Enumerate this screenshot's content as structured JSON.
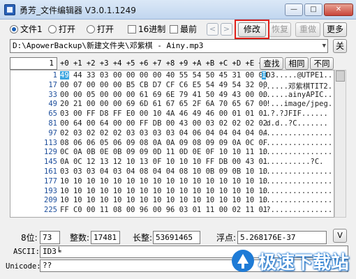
{
  "window": {
    "title": "勇芳_文件编辑器 V3.0.1.1249",
    "minimize": "—",
    "maximize": "□",
    "close": "✕"
  },
  "toolbar": {
    "radio_file1": "文件1",
    "radio_open1": "打开",
    "radio_open2": "打开",
    "check_hex": "16进制",
    "check_front": "最前",
    "nav_prev": "<",
    "nav_next": ">",
    "btn_modify": "修改",
    "btn_restore": "恢复",
    "btn_redo": "重做",
    "btn_more": "更多"
  },
  "path": {
    "value": "D:\\ApowerBackup\\新建文件夹\\邓紫棋 - Ainy.mp3",
    "close_label": "关"
  },
  "hex": {
    "address_input": "1",
    "column_header": "+0 +1 +2 +3 +4 +5 +6 +7 +8 +9 +A +B +C +D +E +F",
    "btn_find": "查找",
    "btn_same": "相同",
    "btn_diff": "不同",
    "selected_byte": "49",
    "selected_char": "I",
    "rows": [
      {
        "offset": "1",
        "bytes": "   44 33 03 00 00 00 00 40 55 54 50 45 31 00 00",
        "ascii": "D3.....@UTPE1.."
      },
      {
        "offset": "17",
        "bytes": "00 07 00 00 00 B5 CB D7 CF C6 E5 54 49 54 32 00",
        "ascii": "......邓紫棋TIT2."
      },
      {
        "offset": "33",
        "bytes": "00 00 05 00 00 00 61 69 6E 79 41 50 49 43 00 00",
        "ascii": "......ainyAPIC.."
      },
      {
        "offset": "49",
        "bytes": "20 21 00 00 00 69 6D 61 67 65 2F 6A 70 65 67 00",
        "ascii": " !...image/jpeg."
      },
      {
        "offset": "65",
        "bytes": "03 00 FF D8 FF E0 00 10 4A 46 49 46 00 01 01 01",
        "ascii": "..?.?JFIF......"
      },
      {
        "offset": "81",
        "bytes": "00 64 00 64 00 00 FF DB 00 43 00 03 02 02 02 02",
        "ascii": ".d.d..?C......."
      },
      {
        "offset": "97",
        "bytes": "02 03 02 02 02 03 03 03 03 04 06 04 04 04 04 04",
        "ascii": "................"
      },
      {
        "offset": "113",
        "bytes": "08 06 06 05 06 09 08 0A 0A 09 08 09 09 0A 0C 0F",
        "ascii": "................"
      },
      {
        "offset": "129",
        "bytes": "0C 0A 0B 0E 0B 09 09 0D 11 0D 0E 0F 10 10 11 10",
        "ascii": "................"
      },
      {
        "offset": "145",
        "bytes": "0A 0C 12 13 12 10 13 0F 10 10 10 FF DB 00 43 01",
        "ascii": "...........?C."
      },
      {
        "offset": "161",
        "bytes": "03 03 03 04 03 04 08 04 04 08 10 0B 09 0B 10 10",
        "ascii": "................"
      },
      {
        "offset": "177",
        "bytes": "10 10 10 10 10 10 10 10 10 10 10 10 10 10 10 10",
        "ascii": "................"
      },
      {
        "offset": "193",
        "bytes": "10 10 10 10 10 10 10 10 10 10 10 10 10 10 10 10",
        "ascii": "................"
      },
      {
        "offset": "209",
        "bytes": "10 10 10 10 10 10 10 10 10 10 10 10 10 10 10 10",
        "ascii": "................"
      },
      {
        "offset": "225",
        "bytes": "FF C0 00 11 08 00 96 00 96 03 01 11 00 02 11 01",
        "ascii": ".?.............."
      }
    ]
  },
  "info": {
    "label_8bit": "8位:",
    "val_8bit": "73",
    "label_int": "整数:",
    "val_int": "17481",
    "label_long": "长整:",
    "val_long": "53691465",
    "label_float": "浮点:",
    "val_float": "5.268176E-37",
    "btn_v": "V"
  },
  "bottom": {
    "ascii_label": "ASCII:",
    "ascii_value": "ID3╘",
    "unicode_label": "Unicode:",
    "unicode_value": "??"
  },
  "watermark": {
    "text": "极速下载站"
  },
  "colors": {
    "highlight": "#3da6e0",
    "offset_text": "#1d4e9c",
    "red_frame": "#e0201a"
  }
}
